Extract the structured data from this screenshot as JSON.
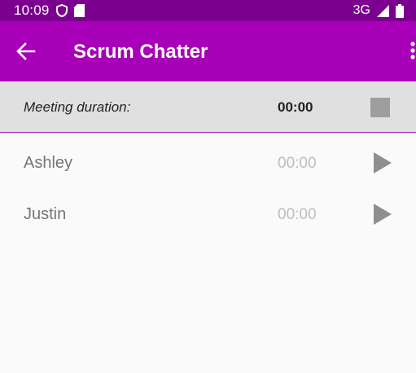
{
  "status_bar": {
    "time": "10:09",
    "network": "3G",
    "icons": [
      "vpn-shield-icon",
      "sd-card-icon",
      "signal-icon",
      "battery-icon"
    ]
  },
  "app_bar": {
    "title": "Scrum Chatter",
    "icons": [
      "back-arrow-icon",
      "overflow-menu-icon"
    ]
  },
  "meeting": {
    "duration_label": "Meeting duration:",
    "duration_value": "00:00"
  },
  "speakers": [
    {
      "name": "Ashley",
      "time": "00:00"
    },
    {
      "name": "Justin",
      "time": "00:00"
    }
  ],
  "colors": {
    "status_bar": "#7b008f",
    "app_bar": "#a800b8",
    "duration_bg": "#e0e0e0",
    "divider": "#9c27b0",
    "control_grey": "#9e9e9e"
  }
}
